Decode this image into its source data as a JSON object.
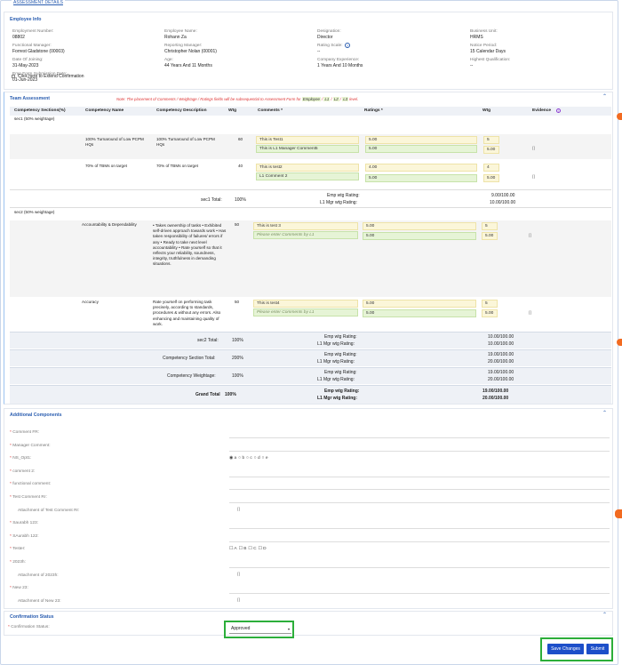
{
  "legend_title": "ASSESSMENT DETAILS",
  "employee_info": {
    "title": "Employee Info",
    "fields": [
      {
        "label": "Employment Number:",
        "value": "08802"
      },
      {
        "label": "Employee Name:",
        "value": "Rohann Za"
      },
      {
        "label": "Designation:",
        "value": "Director"
      },
      {
        "label": "Business Unit:",
        "value": "HRMS"
      },
      {
        "label": "Functional Manager:",
        "value": "Forrest Gladstone (00003)"
      },
      {
        "label": "Reporting Manager:",
        "value": "Christopher Nolan (00001)"
      },
      {
        "label": "Rating Scale:",
        "value": "--"
      },
      {
        "label": "Notice Period:",
        "value": "15 Calendar Days"
      },
      {
        "label": "Date Of Joining:",
        "value": "31-May-2023"
      },
      {
        "label": "Age:",
        "value": "44 Years And 11 Months"
      },
      {
        "label": "Company Experience:",
        "value": "1 Years And 10 Months"
      },
      {
        "label": "Highest Qualification:",
        "value": "--"
      },
      {
        "label": "Emp Form Submission Date:",
        "value": "01-Jun-2023"
      }
    ],
    "extend_confirmation": "Click here to Extend Confirmation"
  },
  "team_assessment": {
    "title": "Team Assessment",
    "note": "Note: The placement of Comments / Weightage / Ratings fields will be subsequential to Assessment Form for",
    "note_tags": [
      "Employee",
      "L1",
      "L2",
      "L3"
    ],
    "note_end": "level.",
    "headers": [
      "Competency Sections(%)",
      "Competency Name",
      "Competency Description",
      "Wtg",
      "Comments *",
      "Ratings *",
      "Wtg",
      "Evidence"
    ],
    "sec1": {
      "name": "sec1 (50% weightage)",
      "rows": [
        {
          "name": "100% Turnaround of Low PCPM HQs",
          "desc": "100% Turnaround of Low PCPM HQs",
          "wtg": "60",
          "emp_comment": "This is Test1",
          "l1_comment": "This is L1 Manager Comment5",
          "emp_rating": "5.00",
          "l1_rating": "5.00",
          "emp_wtg": "5",
          "l1_wtg": "5.00"
        },
        {
          "name": "70% of TBMs on target",
          "desc": "70% of TBMs on target",
          "wtg": "40",
          "emp_comment": "This is test2",
          "l1_comment": "L1 Comment 2",
          "emp_rating": "4.00",
          "l1_rating": "5.00",
          "emp_wtg": "4",
          "l1_wtg": "5.00"
        }
      ],
      "total_label": "sec1 Total:",
      "total_pct": "100%",
      "emp_label": "Emp wtg Rating:",
      "emp_val": "9.00/100.00",
      "l1_label": "L1 Mgr wtg Rating:",
      "l1_val": "10.00/100.00"
    },
    "sec2": {
      "name": "sec2 (50% weightage)",
      "rows": [
        {
          "name": "Accountability & Dependability",
          "desc": "• Takes ownership of tasks • Exhibited self-driven approach towards work • Has taken responsibility of failures/ errors if any • Ready to take next level accountability • Rate yourself so that it reflects your reliability, soundness, integrity, truthfulness in demanding situations.",
          "wtg": "50",
          "emp_comment": "This is test 3",
          "l1_placeholder": "Please enter Comments by L1",
          "emp_rating": "5.00",
          "l1_rating": "5.00",
          "emp_wtg": "5",
          "l1_wtg": "5.00"
        },
        {
          "name": "Accuracy",
          "desc": "Rate yourself on performing task precisely, according to standards, procedures & without any errors. Also enhancing and maintaining quality of work.",
          "wtg": "50",
          "emp_comment": "This is test4",
          "l1_placeholder": "Please enter Comments by L1",
          "emp_rating": "5.00",
          "l1_rating": "5.00",
          "emp_wtg": "5",
          "l1_wtg": "5.00"
        }
      ],
      "total_label": "sec2 Total:",
      "total_pct": "100%",
      "emp_val": "10.00/100.00",
      "l1_val": "10.00/100.00"
    },
    "section_total": {
      "label": "Competency Section Total:",
      "pct": "200%",
      "emp_val": "19.00/100.00",
      "l1_val": "20.00/100.00"
    },
    "weightage": {
      "label": "Competency Weightage:",
      "pct": "100%",
      "emp_val": "19.00/100.00",
      "l1_val": "20.00/100.00"
    },
    "grand_total": {
      "label": "Grand Total",
      "pct": "100%",
      "emp_val": "19.00/100.00",
      "l1_val": "20.00/100.00"
    }
  },
  "additional": {
    "title": "Additional Components",
    "fields": [
      "Comment FR:",
      "Manager Comment:",
      "NS_Opt1:",
      "comment 2:",
      "functional comment:",
      "Test Comment Rr:",
      "Attachment of Test Comment Rr:",
      "Saurabh 123:",
      "SAurabh 122:",
      "Tester:",
      "2023h:",
      "Attachment of 2023h:",
      "New 23:",
      "Attachment of New 23:"
    ],
    "radio_options": [
      "a",
      "b",
      "c",
      "d",
      "e"
    ],
    "check_options": [
      "A",
      "B",
      "C",
      "D"
    ]
  },
  "confirmation": {
    "title": "Confirmation Status",
    "label": "Confirmation Status:",
    "value": "Approved"
  },
  "buttons": {
    "save": "Save Changes",
    "submit": "Submit"
  }
}
